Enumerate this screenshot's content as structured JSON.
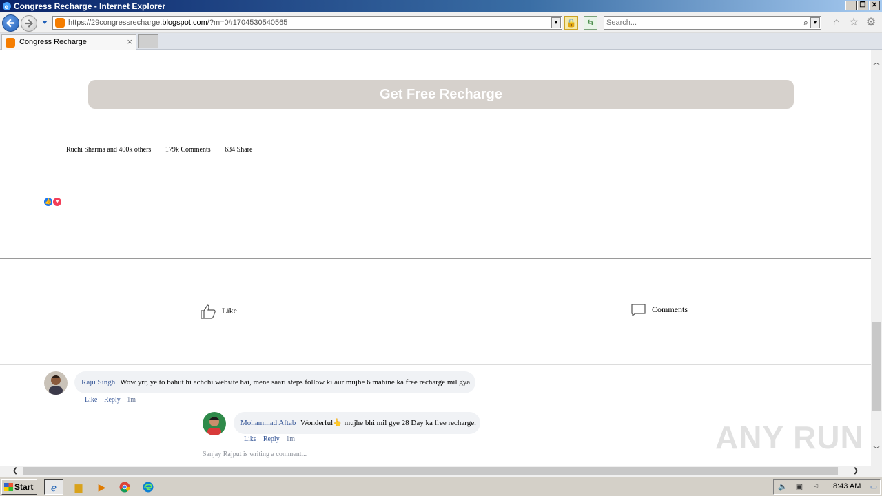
{
  "window": {
    "title": "Congress Recharge - Internet Explorer",
    "controls": {
      "minimize": "_",
      "restore": "❐",
      "close": "✕"
    }
  },
  "navbar": {
    "url_prefix": "https://29congressrecharge.",
    "url_domain": "blogspot.com",
    "url_path": "/?m=0#1704530540565",
    "search_placeholder": "Search..."
  },
  "tabs": [
    {
      "label": "Congress Recharge",
      "close": "×"
    }
  ],
  "page": {
    "cta_label": "Get Free Recharge",
    "stats": {
      "reactions_by": "Ruchi Sharma and 400k others",
      "comments": "179k  Comments",
      "shares": "634  Share"
    },
    "actions": {
      "like": "Like",
      "comments": "Comments"
    },
    "comments": [
      {
        "author": "Raju Singh",
        "text": "Wow yrr, ye to bahut hi achchi website hai, mene saari steps follow ki aur mujhe 6 mahine ka free recharge mil gya",
        "like": "Like",
        "reply": "Reply",
        "time": "1m"
      },
      {
        "author": "Mohammad Aftab",
        "text": "Wonderful👆 mujhe bhi mil gye 28 Day ka free recharge.",
        "like": "Like",
        "reply": "Reply",
        "time": "1m"
      }
    ],
    "typing_indicator": "Sanjay Rajput is writing a comment..."
  },
  "watermark": "ANY RUN",
  "taskbar": {
    "start_label": "Start",
    "clock": "8:43 AM"
  },
  "colors": {
    "cta_bg": "#d6d1cc",
    "link_blue": "#385898",
    "title_gradient_start": "#0a246a"
  }
}
